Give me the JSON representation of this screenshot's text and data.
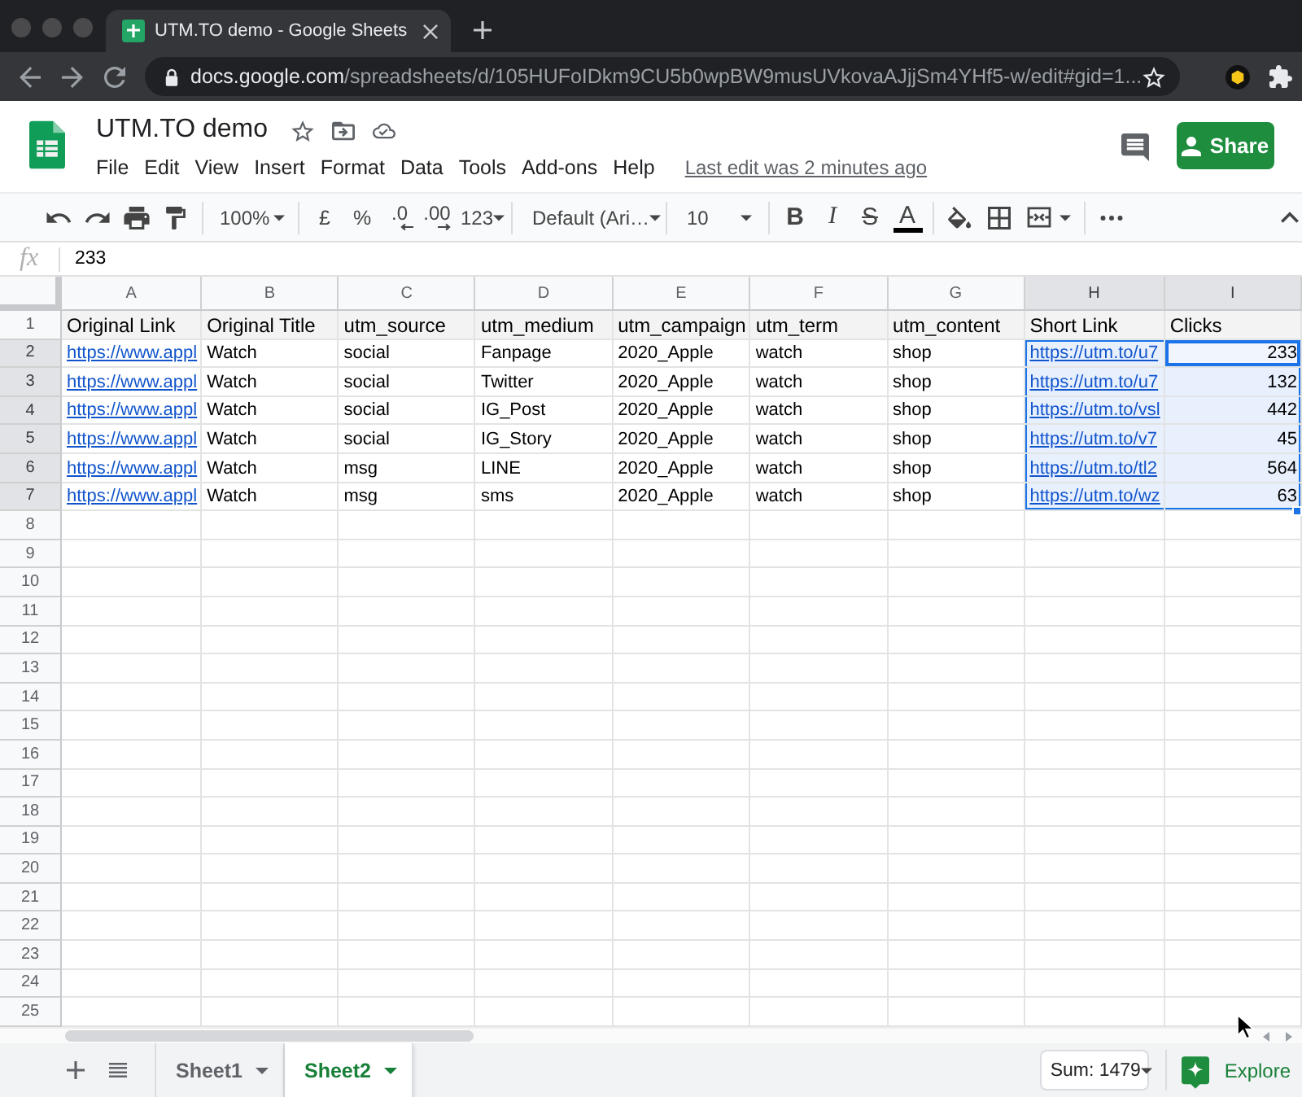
{
  "browser": {
    "tab": {
      "title": "UTM.TO demo - Google Sheets"
    },
    "url": {
      "host": "docs.google.com",
      "path": "/spreadsheets/d/105HUFoIDkm9CU5b0wpBW9musUVkovaAJjjSm4YHf5-w/edit#gid=1..."
    }
  },
  "document": {
    "title": "UTM.TO demo",
    "menu": [
      "File",
      "Edit",
      "View",
      "Insert",
      "Format",
      "Data",
      "Tools",
      "Add-ons",
      "Help"
    ],
    "last_edit": "Last edit was 2 minutes ago",
    "share": "Share"
  },
  "toolbar": {
    "zoom": "100%",
    "currency": "£",
    "percent": "%",
    "decimal_decrease": ".0",
    "decimal_increase": ".00",
    "number_format": "123",
    "font": "Default (Ari…",
    "font_size": "10",
    "bold": "B",
    "italic": "I",
    "strikethrough": "S",
    "text_color": "A"
  },
  "formula_bar": {
    "label": "fx",
    "value": "233"
  },
  "grid": {
    "columns": [
      {
        "letter": "A",
        "selected": false
      },
      {
        "letter": "B",
        "selected": false
      },
      {
        "letter": "C",
        "selected": false
      },
      {
        "letter": "D",
        "selected": false
      },
      {
        "letter": "E",
        "selected": false
      },
      {
        "letter": "F",
        "selected": false
      },
      {
        "letter": "G",
        "selected": false
      },
      {
        "letter": "H",
        "selected": true
      },
      {
        "letter": "I",
        "selected": true
      }
    ],
    "rows": [
      {
        "number": "1",
        "selected": false,
        "kind": "header",
        "cells": [
          {
            "text": "Original Link",
            "kind": "text",
            "selected": false,
            "active": false
          },
          {
            "text": "Original Title",
            "kind": "text",
            "selected": false,
            "active": false
          },
          {
            "text": "utm_source",
            "kind": "text",
            "selected": false,
            "active": false
          },
          {
            "text": "utm_medium",
            "kind": "text",
            "selected": false,
            "active": false
          },
          {
            "text": "utm_campaign",
            "kind": "text",
            "selected": false,
            "active": false
          },
          {
            "text": "utm_term",
            "kind": "text",
            "selected": false,
            "active": false
          },
          {
            "text": "utm_content",
            "kind": "text",
            "selected": false,
            "active": false
          },
          {
            "text": "Short Link",
            "kind": "text",
            "selected": false,
            "active": false
          },
          {
            "text": "Clicks",
            "kind": "text",
            "selected": false,
            "active": false
          }
        ]
      },
      {
        "number": "2",
        "selected": true,
        "kind": "data",
        "cells": [
          {
            "text": "https://www.appl",
            "kind": "link",
            "selected": false,
            "active": false
          },
          {
            "text": "Watch",
            "kind": "text",
            "selected": false,
            "active": false
          },
          {
            "text": "social",
            "kind": "text",
            "selected": false,
            "active": false
          },
          {
            "text": "Fanpage",
            "kind": "text",
            "selected": false,
            "active": false
          },
          {
            "text": "2020_Apple",
            "kind": "text",
            "selected": false,
            "active": false
          },
          {
            "text": "watch",
            "kind": "text",
            "selected": false,
            "active": false
          },
          {
            "text": "shop",
            "kind": "text",
            "selected": false,
            "active": false
          },
          {
            "text": "https://utm.to/u7",
            "kind": "link",
            "selected": true,
            "active": false
          },
          {
            "text": "233",
            "kind": "number",
            "selected": true,
            "active": true
          }
        ]
      },
      {
        "number": "3",
        "selected": true,
        "kind": "data",
        "cells": [
          {
            "text": "https://www.appl",
            "kind": "link",
            "selected": false,
            "active": false
          },
          {
            "text": "Watch",
            "kind": "text",
            "selected": false,
            "active": false
          },
          {
            "text": "social",
            "kind": "text",
            "selected": false,
            "active": false
          },
          {
            "text": "Twitter",
            "kind": "text",
            "selected": false,
            "active": false
          },
          {
            "text": "2020_Apple",
            "kind": "text",
            "selected": false,
            "active": false
          },
          {
            "text": "watch",
            "kind": "text",
            "selected": false,
            "active": false
          },
          {
            "text": "shop",
            "kind": "text",
            "selected": false,
            "active": false
          },
          {
            "text": "https://utm.to/u7",
            "kind": "link",
            "selected": true,
            "active": false
          },
          {
            "text": "132",
            "kind": "number",
            "selected": true,
            "active": false
          }
        ]
      },
      {
        "number": "4",
        "selected": true,
        "kind": "data",
        "cells": [
          {
            "text": "https://www.appl",
            "kind": "link",
            "selected": false,
            "active": false
          },
          {
            "text": "Watch",
            "kind": "text",
            "selected": false,
            "active": false
          },
          {
            "text": "social",
            "kind": "text",
            "selected": false,
            "active": false
          },
          {
            "text": "IG_Post",
            "kind": "text",
            "selected": false,
            "active": false
          },
          {
            "text": "2020_Apple",
            "kind": "text",
            "selected": false,
            "active": false
          },
          {
            "text": "watch",
            "kind": "text",
            "selected": false,
            "active": false
          },
          {
            "text": "shop",
            "kind": "text",
            "selected": false,
            "active": false
          },
          {
            "text": "https://utm.to/vsl",
            "kind": "link",
            "selected": true,
            "active": false
          },
          {
            "text": "442",
            "kind": "number",
            "selected": true,
            "active": false
          }
        ]
      },
      {
        "number": "5",
        "selected": true,
        "kind": "data",
        "cells": [
          {
            "text": "https://www.appl",
            "kind": "link",
            "selected": false,
            "active": false
          },
          {
            "text": "Watch",
            "kind": "text",
            "selected": false,
            "active": false
          },
          {
            "text": "social",
            "kind": "text",
            "selected": false,
            "active": false
          },
          {
            "text": "IG_Story",
            "kind": "text",
            "selected": false,
            "active": false
          },
          {
            "text": "2020_Apple",
            "kind": "text",
            "selected": false,
            "active": false
          },
          {
            "text": "watch",
            "kind": "text",
            "selected": false,
            "active": false
          },
          {
            "text": "shop",
            "kind": "text",
            "selected": false,
            "active": false
          },
          {
            "text": "https://utm.to/v7",
            "kind": "link",
            "selected": true,
            "active": false
          },
          {
            "text": "45",
            "kind": "number",
            "selected": true,
            "active": false
          }
        ]
      },
      {
        "number": "6",
        "selected": true,
        "kind": "data",
        "cells": [
          {
            "text": "https://www.appl",
            "kind": "link",
            "selected": false,
            "active": false
          },
          {
            "text": "Watch",
            "kind": "text",
            "selected": false,
            "active": false
          },
          {
            "text": "msg",
            "kind": "text",
            "selected": false,
            "active": false
          },
          {
            "text": "LINE",
            "kind": "text",
            "selected": false,
            "active": false
          },
          {
            "text": "2020_Apple",
            "kind": "text",
            "selected": false,
            "active": false
          },
          {
            "text": "watch",
            "kind": "text",
            "selected": false,
            "active": false
          },
          {
            "text": "shop",
            "kind": "text",
            "selected": false,
            "active": false
          },
          {
            "text": "https://utm.to/tl2",
            "kind": "link",
            "selected": true,
            "active": false
          },
          {
            "text": "564",
            "kind": "number",
            "selected": true,
            "active": false
          }
        ]
      },
      {
        "number": "7",
        "selected": true,
        "kind": "data",
        "cells": [
          {
            "text": "https://www.appl",
            "kind": "link",
            "selected": false,
            "active": false
          },
          {
            "text": "Watch",
            "kind": "text",
            "selected": false,
            "active": false
          },
          {
            "text": "msg",
            "kind": "text",
            "selected": false,
            "active": false
          },
          {
            "text": "sms",
            "kind": "text",
            "selected": false,
            "active": false
          },
          {
            "text": "2020_Apple",
            "kind": "text",
            "selected": false,
            "active": false
          },
          {
            "text": "watch",
            "kind": "text",
            "selected": false,
            "active": false
          },
          {
            "text": "shop",
            "kind": "text",
            "selected": false,
            "active": false
          },
          {
            "text": "https://utm.to/wz",
            "kind": "link",
            "selected": true,
            "active": false
          },
          {
            "text": "63",
            "kind": "number",
            "selected": true,
            "active": false
          }
        ]
      },
      {
        "number": "8",
        "selected": false
      },
      {
        "number": "9",
        "selected": false
      },
      {
        "number": "10",
        "selected": false
      },
      {
        "number": "11",
        "selected": false
      },
      {
        "number": "12",
        "selected": false
      },
      {
        "number": "13",
        "selected": false
      },
      {
        "number": "14",
        "selected": false
      },
      {
        "number": "15",
        "selected": false
      },
      {
        "number": "16",
        "selected": false
      },
      {
        "number": "17",
        "selected": false
      },
      {
        "number": "18",
        "selected": false
      },
      {
        "number": "19",
        "selected": false
      },
      {
        "number": "20",
        "selected": false
      },
      {
        "number": "21",
        "selected": false
      },
      {
        "number": "22",
        "selected": false
      },
      {
        "number": "23",
        "selected": false
      },
      {
        "number": "24",
        "selected": false
      },
      {
        "number": "25",
        "selected": false
      }
    ]
  },
  "sheets": [
    {
      "name": "Sheet1",
      "selected": false
    },
    {
      "name": "Sheet2",
      "selected": true
    }
  ],
  "status": {
    "sum": "Sum: 1479",
    "explore": "Explore"
  }
}
